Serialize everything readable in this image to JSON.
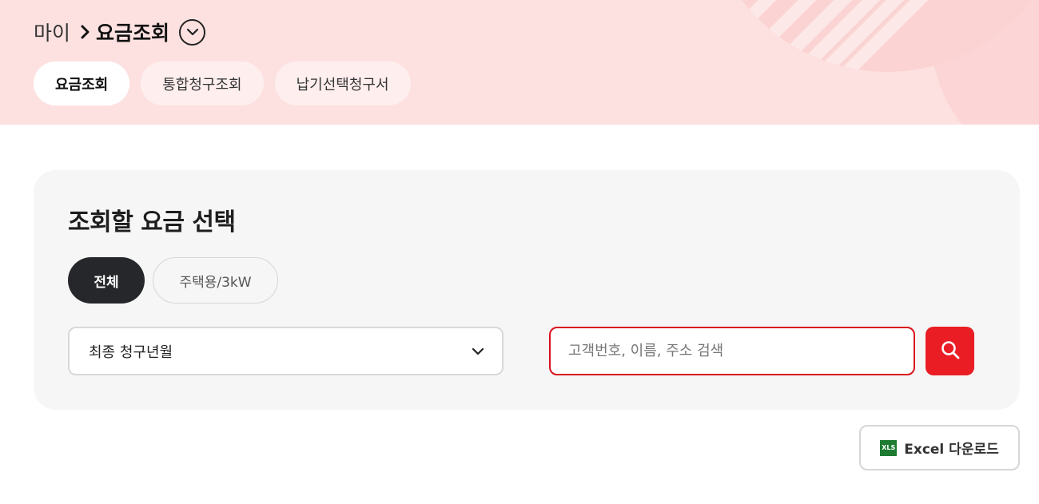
{
  "breadcrumb": {
    "parent": "마이",
    "current": "요금조회"
  },
  "tabs": [
    {
      "label": "요금조회",
      "active": true
    },
    {
      "label": "통합청구조회",
      "active": false
    },
    {
      "label": "납기선택청구서",
      "active": false
    }
  ],
  "panel": {
    "title": "조회할 요금 선택",
    "chips": [
      {
        "label": "전체",
        "active": true
      },
      {
        "label": "주택용/3kW",
        "active": false
      }
    ],
    "select": {
      "value": "최종 청구년월"
    },
    "search": {
      "placeholder": "고객번호, 이름, 주소 검색",
      "value": ""
    }
  },
  "excel": {
    "badge": "XLS",
    "label": "Excel 다운로드"
  },
  "icons": {
    "breadcrumb_separator": "chevron-right-icon",
    "breadcrumb_toggle": "chevron-down-circle-icon",
    "select_arrow": "chevron-down-icon",
    "search": "search-icon",
    "excel": "xls-file-icon"
  },
  "colors": {
    "hero_bg": "#fde1e1",
    "accent_red": "#ea1d25",
    "chip_active_bg": "#26272b",
    "panel_bg": "#f6f6f6",
    "excel_green": "#1d7b32"
  }
}
